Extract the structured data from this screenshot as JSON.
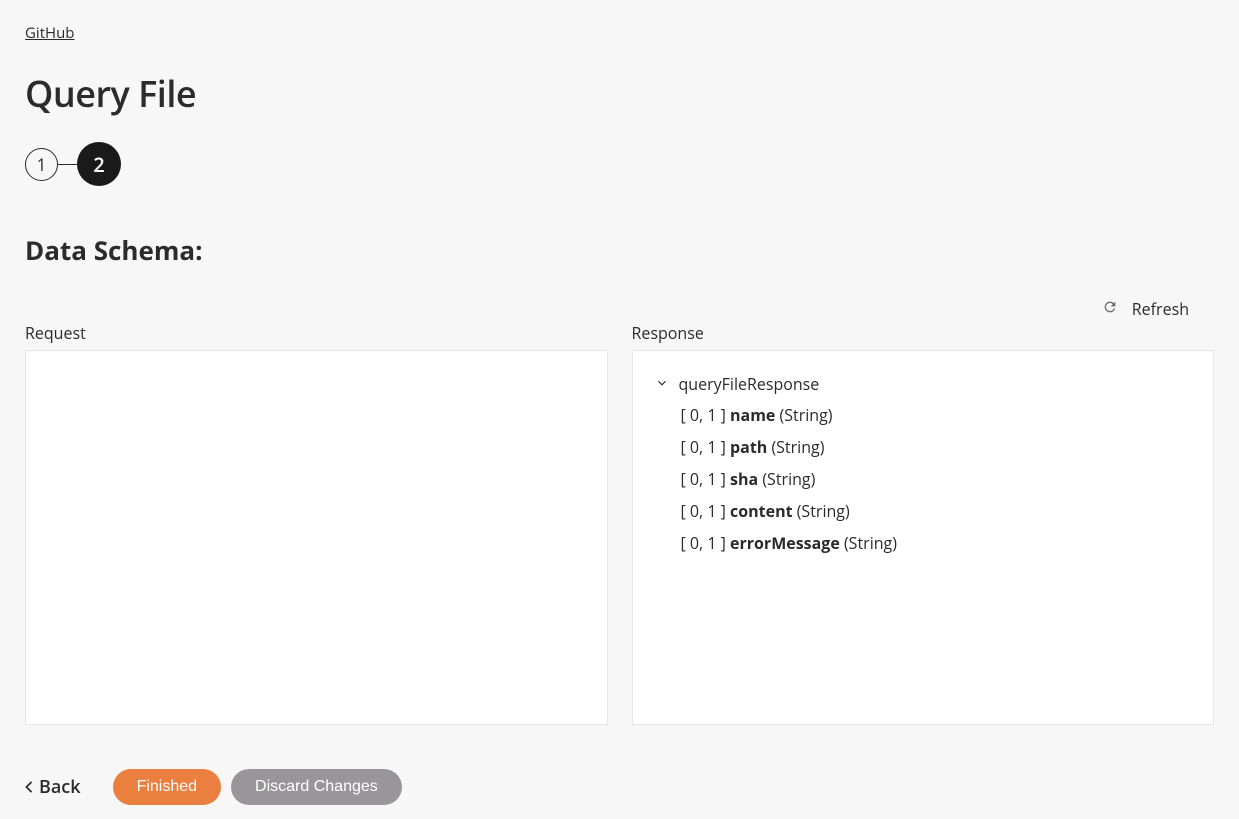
{
  "breadcrumb": {
    "label": "GitHub"
  },
  "page": {
    "title": "Query File",
    "section_title": "Data Schema:"
  },
  "stepper": {
    "step1": "1",
    "step2": "2"
  },
  "refresh": {
    "label": "Refresh"
  },
  "panels": {
    "request_label": "Request",
    "response_label": "Response"
  },
  "response_tree": {
    "root": "queryFileResponse",
    "fields": [
      {
        "prefix": "[ 0, 1 ] ",
        "name": "name",
        "type": " (String)"
      },
      {
        "prefix": "[ 0, 1 ] ",
        "name": "path",
        "type": " (String)"
      },
      {
        "prefix": "[ 0, 1 ] ",
        "name": "sha",
        "type": " (String)"
      },
      {
        "prefix": "[ 0, 1 ] ",
        "name": "content",
        "type": " (String)"
      },
      {
        "prefix": "[ 0, 1 ] ",
        "name": "errorMessage",
        "type": " (String)"
      }
    ]
  },
  "footer": {
    "back": "Back",
    "finished": "Finished",
    "discard": "Discard Changes"
  }
}
